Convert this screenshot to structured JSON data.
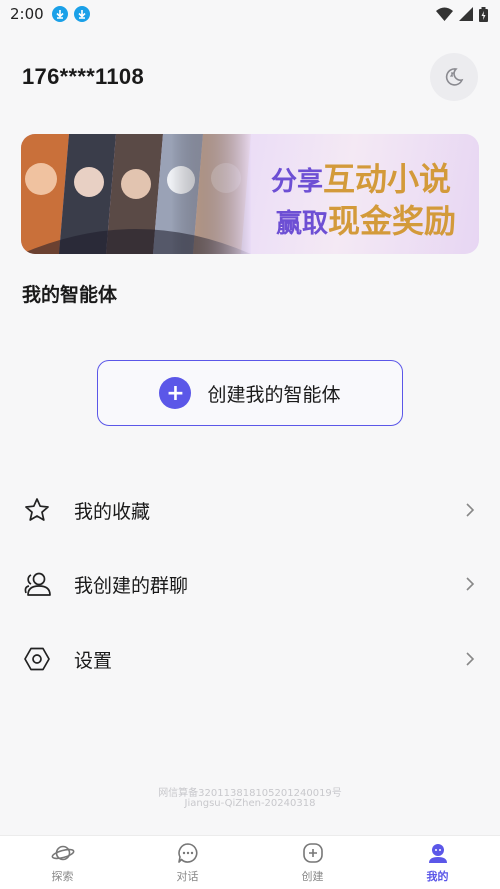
{
  "status_bar": {
    "time": "2:00",
    "icons": [
      "download-icon",
      "download-icon",
      "wifi-icon",
      "signal-icon",
      "battery-icon"
    ]
  },
  "profile": {
    "phone": "176****1108",
    "night_mode_icon": "moon-icon"
  },
  "banner": {
    "line1_prefix": "分享",
    "line1_highlight": "互动小说",
    "line2_prefix": "赢取",
    "line2_highlight": "现金奖励"
  },
  "agents": {
    "title": "我的智能体",
    "create_label": "创建我的智能体"
  },
  "menu": [
    {
      "label": "我的收藏",
      "icon": "star-icon"
    },
    {
      "label": "我创建的群聊",
      "icon": "group-icon"
    },
    {
      "label": "设置",
      "icon": "settings-icon"
    }
  ],
  "footer": {
    "icp_line1": "网信算备320113818105201240019号",
    "icp_line2": "Jiangsu-QiZhen-20240318"
  },
  "tabbar": [
    {
      "label": "探索",
      "icon": "planet-icon",
      "active": false
    },
    {
      "label": "对话",
      "icon": "chat-icon",
      "active": false
    },
    {
      "label": "创建",
      "icon": "plus-square-icon",
      "active": false
    },
    {
      "label": "我的",
      "icon": "profile-icon",
      "active": true
    }
  ],
  "colors": {
    "accent": "#5b57e8",
    "background": "#f7f7f8",
    "banner_purple": "#6d4fd4",
    "banner_gold": "#d39a3a"
  }
}
